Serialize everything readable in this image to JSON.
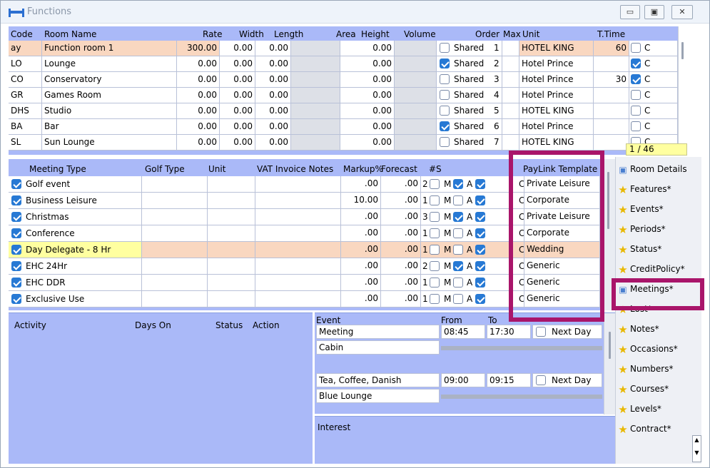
{
  "window": {
    "title": "Functions",
    "minimize_icon": "minimize-icon",
    "maximize_icon": "maximize-icon",
    "close_icon": "close-icon"
  },
  "rooms": {
    "headers": {
      "code": "Code",
      "name": "Room Name",
      "rate": "Rate",
      "width": "Width",
      "length": "Length",
      "area": "Area",
      "height": "Height",
      "volume": "Volume",
      "order": "Order",
      "max": "Max",
      "unit": "Unit",
      "ttime": "T.Time"
    },
    "rows": [
      {
        "code": "ay",
        "name": "Function room 1",
        "rate": "300.00",
        "width": "0.00",
        "length": "0.00",
        "height": "0.00",
        "shared_checked": false,
        "shared": "Shared",
        "order": "1",
        "unit": "HOTEL KING",
        "ttime": "60",
        "c_checked": false,
        "c": "C"
      },
      {
        "code": "LO",
        "name": "Lounge",
        "rate": "0.00",
        "width": "0.00",
        "length": "0.00",
        "height": "0.00",
        "shared_checked": true,
        "shared": "Shared",
        "order": "2",
        "unit": "Hotel Prince",
        "ttime": "",
        "c_checked": true,
        "c": "C"
      },
      {
        "code": "CO",
        "name": "Conservatory",
        "rate": "0.00",
        "width": "0.00",
        "length": "0.00",
        "height": "0.00",
        "shared_checked": false,
        "shared": "Shared",
        "order": "3",
        "unit": "Hotel Prince",
        "ttime": "30",
        "c_checked": true,
        "c": "C"
      },
      {
        "code": "GR",
        "name": "Games Room",
        "rate": "0.00",
        "width": "0.00",
        "length": "0.00",
        "height": "0.00",
        "shared_checked": false,
        "shared": "Shared",
        "order": "4",
        "unit": "Hotel Prince",
        "ttime": "",
        "c_checked": false,
        "c": "C"
      },
      {
        "code": "DHS",
        "name": "Studio",
        "rate": "0.00",
        "width": "0.00",
        "length": "0.00",
        "height": "0.00",
        "shared_checked": false,
        "shared": "Shared",
        "order": "5",
        "unit": "HOTEL KING",
        "ttime": "",
        "c_checked": false,
        "c": "C"
      },
      {
        "code": "BA",
        "name": "Bar",
        "rate": "0.00",
        "width": "0.00",
        "length": "0.00",
        "height": "0.00",
        "shared_checked": true,
        "shared": "Shared",
        "order": "6",
        "unit": "Hotel Prince",
        "ttime": "",
        "c_checked": false,
        "c": "C"
      },
      {
        "code": "SL",
        "name": "Sun Lounge",
        "rate": "0.00",
        "width": "0.00",
        "length": "0.00",
        "height": "0.00",
        "shared_checked": false,
        "shared": "Shared",
        "order": "7",
        "unit": "HOTEL KING",
        "ttime": "",
        "c_checked": false,
        "c": "C"
      }
    ],
    "record_count": "1 / 46"
  },
  "meetings": {
    "headers": {
      "type": "Meeting Type",
      "golf": "Golf Type",
      "unit": "Unit",
      "vat": "VAT Invoice Notes",
      "markup": "Markup%",
      "forecast": "Forecast",
      "s": "#S",
      "paylink": "PayLink Template"
    },
    "rows": [
      {
        "type": "Golf event",
        "checked": true,
        "markup": ".00",
        "forecast": ".00",
        "s": "2",
        "m": false,
        "a": true,
        "c": true,
        "template": "Private Leisure"
      },
      {
        "type": "Business Leisure",
        "checked": true,
        "markup": "10.00",
        "forecast": ".00",
        "s": "1",
        "m": false,
        "a": false,
        "c": true,
        "template": "Corporate"
      },
      {
        "type": "Christmas",
        "checked": true,
        "markup": ".00",
        "forecast": ".00",
        "s": "3",
        "m": false,
        "a": true,
        "c": true,
        "template": "Private Leisure"
      },
      {
        "type": "Conference",
        "checked": true,
        "markup": ".00",
        "forecast": ".00",
        "s": "1",
        "m": false,
        "a": false,
        "c": true,
        "template": "Corporate"
      },
      {
        "type": "Day Delegate - 8 Hr",
        "checked": true,
        "markup": ".00",
        "forecast": ".00",
        "s": "1",
        "m": false,
        "a": false,
        "c": true,
        "template": "Wedding"
      },
      {
        "type": "EHC 24Hr",
        "checked": true,
        "markup": ".00",
        "forecast": ".00",
        "s": "2",
        "m": false,
        "a": true,
        "c": true,
        "template": "Generic"
      },
      {
        "type": "EHC DDR",
        "checked": true,
        "markup": ".00",
        "forecast": ".00",
        "s": "1",
        "m": false,
        "a": false,
        "c": true,
        "template": "Generic"
      },
      {
        "type": "Exclusive Use",
        "checked": true,
        "markup": ".00",
        "forecast": ".00",
        "s": "1",
        "m": false,
        "a": false,
        "c": true,
        "template": "Generic"
      }
    ],
    "m_label": "M",
    "a_label": "A",
    "c_label": "C"
  },
  "activity": {
    "headers": {
      "activity": "Activity",
      "days": "Days On",
      "status": "Status",
      "action": "Action"
    }
  },
  "events": {
    "headers": {
      "event": "Event",
      "from": "From",
      "to": "To"
    },
    "items": [
      {
        "event": "Meeting",
        "from": "08:45",
        "to": "17:30",
        "next_day": "Next Day",
        "location": "Cabin"
      },
      {
        "event": "Tea, Coffee, Danish",
        "from": "09:00",
        "to": "09:15",
        "next_day": "Next Day",
        "location": "Blue Lounge"
      }
    ],
    "interest_label": "Interest"
  },
  "sidebar": {
    "items": [
      {
        "label": "Room Details",
        "icon": "room-details-icon"
      },
      {
        "label": "Features*",
        "icon": "star-icon"
      },
      {
        "label": "Events*",
        "icon": "star-icon"
      },
      {
        "label": "Periods*",
        "icon": "star-icon"
      },
      {
        "label": "Status*",
        "icon": "star-icon"
      },
      {
        "label": "CreditPolicy*",
        "icon": "star-icon"
      },
      {
        "label": "Meetings*",
        "icon": "meetings-icon"
      },
      {
        "label": "Lost*",
        "icon": "star-icon"
      },
      {
        "label": "Notes*",
        "icon": "star-icon"
      },
      {
        "label": "Occasions*",
        "icon": "star-icon"
      },
      {
        "label": "Numbers*",
        "icon": "star-icon"
      },
      {
        "label": "Courses*",
        "icon": "star-icon"
      },
      {
        "label": "Levels*",
        "icon": "star-icon"
      },
      {
        "label": "Contract*",
        "icon": "star-icon"
      }
    ]
  },
  "colors": {
    "panel": "#aab9f8",
    "highlight": "#f9d7c0",
    "accent": "#a9156a",
    "yellow": "#ffffa0"
  }
}
